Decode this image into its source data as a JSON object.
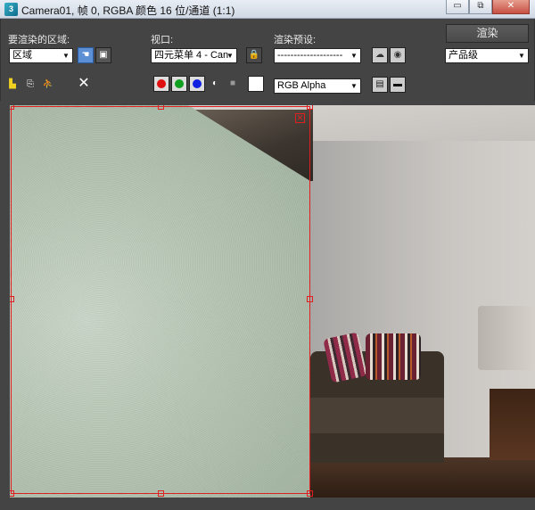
{
  "window": {
    "title": "Camera01, 帧 0, RGBA 颜色 16 位/通道 (1:1)",
    "app_icon": "3ds-max-icon",
    "minimize_glyph": "▭",
    "maximize_glyph": "⧉",
    "close_glyph": "✕"
  },
  "toolbar": {
    "area_label": "要渲染的区域:",
    "area_value": "区域",
    "viewport_label": "视口:",
    "viewport_value": "四元菜单 4 - Can",
    "preset_label": "渲染预设:",
    "preset_value": "--------------------",
    "render_button": "渲染",
    "quality_value": "产品级",
    "channel_value": "RGB Alpha",
    "clear_glyph": "✕"
  },
  "colors": {
    "red_channel": "#e01010",
    "green_channel": "#10a020",
    "blue_channel": "#1020e0",
    "region_outline": "#e02020"
  },
  "icons": [
    "save-image-icon",
    "copy-image-icon",
    "clone-window-icon",
    "clear-icon",
    "edit-region-icon",
    "auto-region-icon",
    "lock-viewport-icon",
    "environment-icon",
    "render-setup-icon",
    "monochrome-icon",
    "alpha-channel-icon",
    "toggle-ui-overlay-icon",
    "toggle-ui-icon"
  ]
}
